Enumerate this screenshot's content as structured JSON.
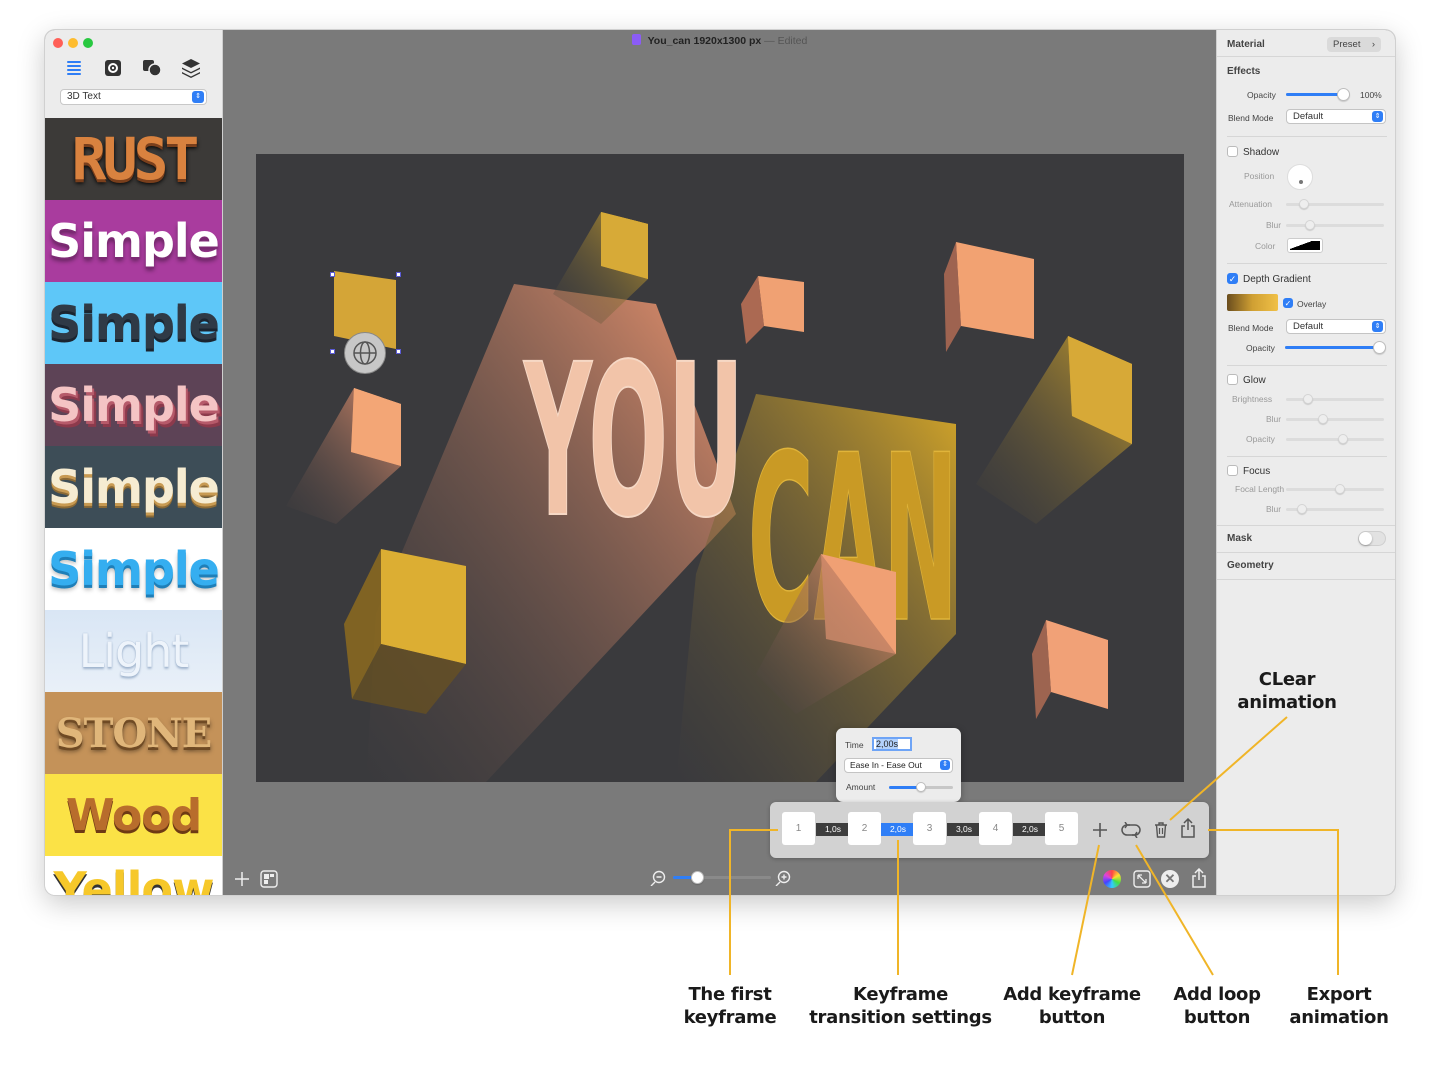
{
  "window": {
    "title": "You_can 1920x1300 px",
    "separator": "—",
    "status": "Edited"
  },
  "sidebar": {
    "style_select": "3D Text",
    "styles": [
      "RUST",
      "Simple",
      "Simple",
      "Simple",
      "Simple",
      "Simple",
      "Light",
      "STONE",
      "Wood",
      "Yellow"
    ]
  },
  "canvas": {
    "text_you": "YOU",
    "text_can": "CAN"
  },
  "inspector": {
    "material_label": "Material",
    "preset_button": "Preset",
    "effects_label": "Effects",
    "opacity_label": "Opacity",
    "opacity_value": "100%",
    "blend_mode_label": "Blend Mode",
    "blend_mode_value": "Default",
    "shadow_label": "Shadow",
    "position_label": "Position",
    "attenuation_label": "Attenuation",
    "blur_label": "Blur",
    "color_label": "Color",
    "depth_gradient_label": "Depth Gradient",
    "overlay_label": "Overlay",
    "dg_blend_mode_label": "Blend Mode",
    "dg_blend_mode_value": "Default",
    "dg_opacity_label": "Opacity",
    "glow_label": "Glow",
    "brightness_label": "Brightness",
    "glow_blur_label": "Blur",
    "glow_opacity_label": "Opacity",
    "focus_label": "Focus",
    "focal_length_label": "Focal Length",
    "focus_blur_label": "Blur",
    "mask_label": "Mask",
    "geometry_label": "Geometry"
  },
  "keyframe_popup": {
    "time_label": "Time",
    "time_value": "2,00s",
    "easing_value": "Ease In - Ease Out",
    "amount_label": "Amount"
  },
  "keyframes": {
    "frames": [
      "1",
      "2",
      "3",
      "4",
      "5"
    ],
    "durations": [
      "1,0s",
      "2,0s",
      "3,0s",
      "2,0s"
    ]
  },
  "annotations": {
    "clear": "CLear animation",
    "first": "The first keyframe",
    "transition": "Keyframe transition settings",
    "add_keyframe": "Add keyframe button",
    "add_loop": "Add loop button",
    "export": "Export animation"
  },
  "colors": {
    "accent": "#2f7ef6",
    "annotation_line": "#f0b528",
    "canvas_bg": "#3a3a3d",
    "peach": "#ec8a67",
    "gold": "#d4a629"
  },
  "progress": {
    "opacity": 0.9,
    "dg_opacity": 1.0,
    "zoom": 0.25,
    "amount": 0.5
  }
}
